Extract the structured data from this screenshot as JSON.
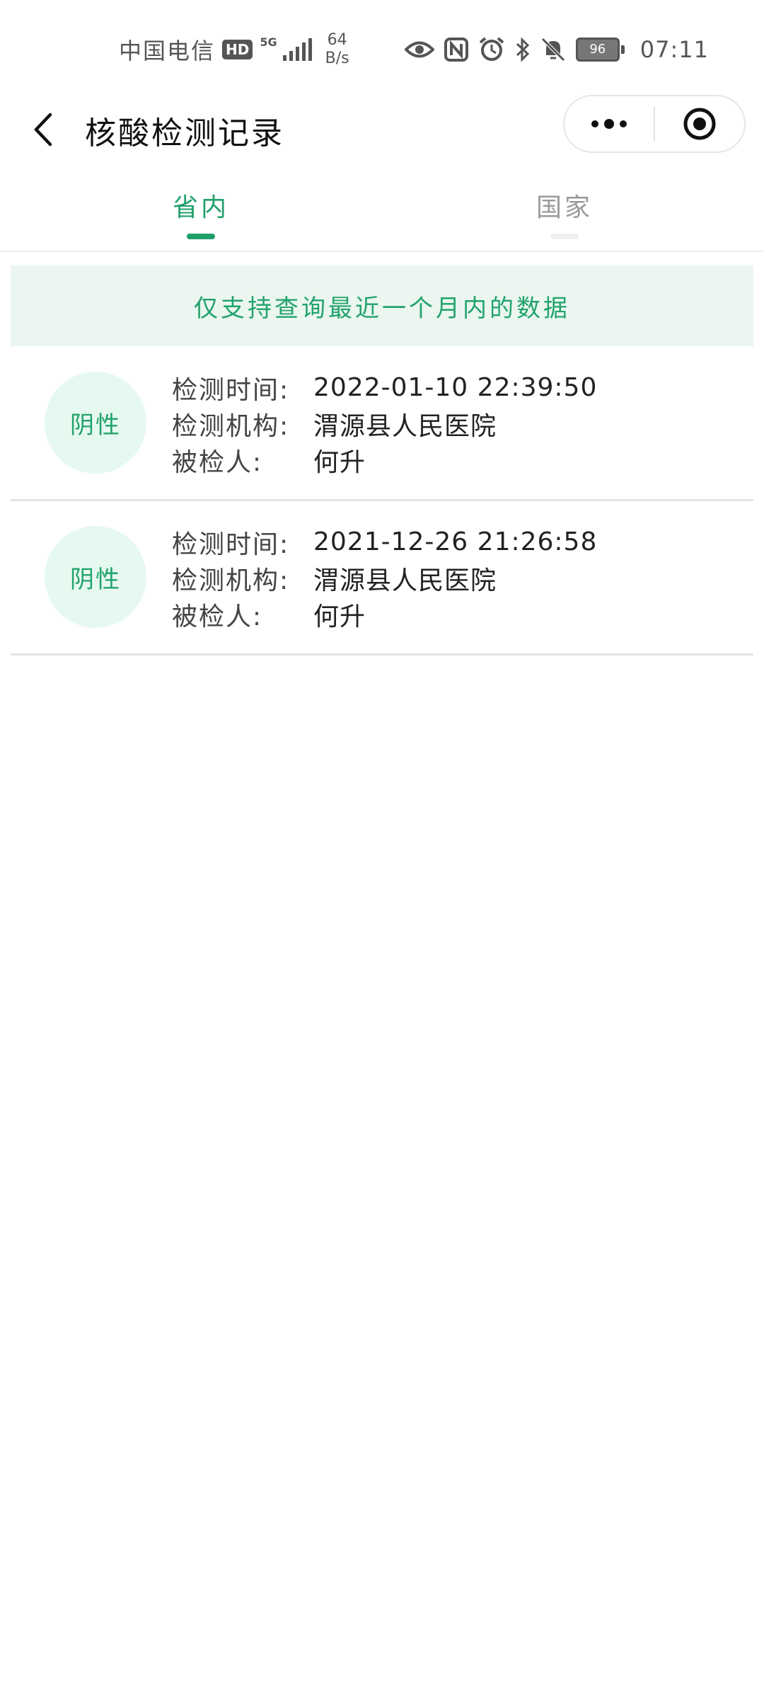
{
  "status_bar": {
    "carrier": "中国电信",
    "hd_badge": "HD",
    "network_type": "5G",
    "speed_value": "64",
    "speed_unit": "B/s",
    "battery": "96",
    "time": "07:11",
    "icons": [
      "hd-icon",
      "signal-icon",
      "eye-icon",
      "nfc-icon",
      "alarm-icon",
      "bluetooth-icon",
      "mute-icon",
      "battery-icon"
    ]
  },
  "nav": {
    "title": "核酸检测记录",
    "back_icon": "chevron-left-icon",
    "more_icon": "more-dots-icon",
    "close_icon": "target-icon"
  },
  "tabs": [
    {
      "label": "省内",
      "active": true
    },
    {
      "label": "国家",
      "active": false
    }
  ],
  "notice": "仅支持查询最近一个月内的数据",
  "records": [
    {
      "result": "阴性",
      "time_label": "检测时间:",
      "time": "2022-01-10 22:39:50",
      "org_label": "检测机构:",
      "org": "渭源县人民医院",
      "person_label": "被检人:",
      "person": "何升"
    },
    {
      "result": "阴性",
      "time_label": "检测时间:",
      "time": "2021-12-26 21:26:58",
      "org_label": "检测机构:",
      "org": "渭源县人民医院",
      "person_label": "被检人:",
      "person": "何升"
    }
  ],
  "colors": {
    "accent": "#1fa06a",
    "notice_bg": "#eaf6ef",
    "badge_bg": "#e6f9f0"
  }
}
